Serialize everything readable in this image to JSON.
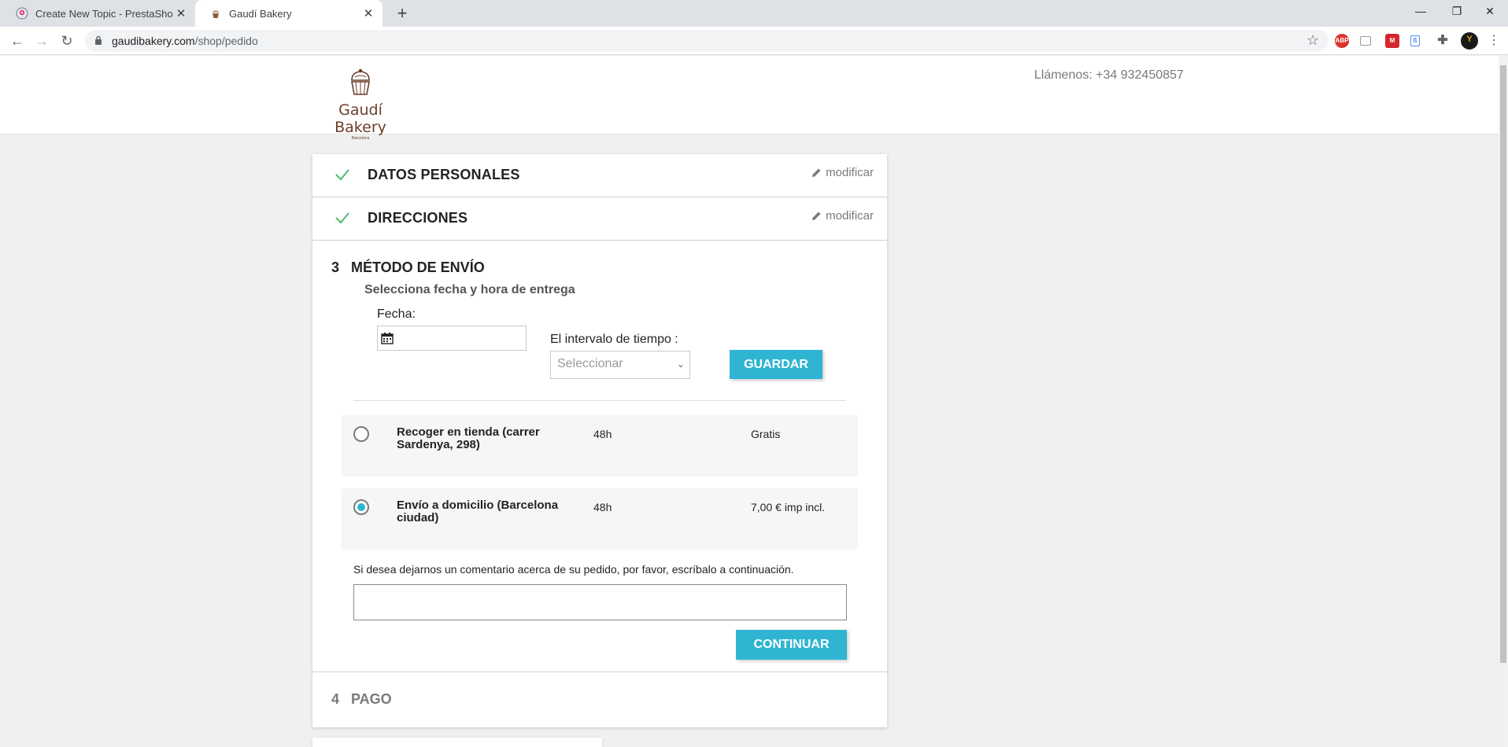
{
  "browser": {
    "tabs": [
      {
        "title": "Create New Topic - PrestaShop F",
        "icon": "prestashop-favicon-icon"
      },
      {
        "title": "Gaudí Bakery",
        "icon": "cupcake-favicon-icon"
      }
    ],
    "url_host": "gaudibakery.com",
    "url_path": "/shop/pedido"
  },
  "header": {
    "logo_text": "Gaudí Bakery",
    "logo_sub": "Barcelona",
    "phone": "Llámenos: +34 932450857"
  },
  "checkout": {
    "edit_label": "modificar",
    "steps_done": [
      "DATOS PERSONALES",
      "DIRECCIONES"
    ],
    "current": {
      "number": "3",
      "title": "MÉTODO DE ENVÍO",
      "subtitle": "Selecciona fecha y hora de entrega",
      "fecha_label": "Fecha:",
      "fecha_value": "",
      "interval_label": "El intervalo de tiempo :",
      "interval_selected": "Seleccionar",
      "save_label": "GUARDAR",
      "carriers": [
        {
          "name": "Recoger en tienda (carrer Sardenya, 298)",
          "delay": "48h",
          "price": "Gratis",
          "selected": false
        },
        {
          "name": "Envío a domicilio (Barcelona ciudad)",
          "delay": "48h",
          "price": "7,00 € imp incl.",
          "selected": true
        }
      ],
      "comment_label": "Si desea dejarnos un comentario acerca de su pedido, por favor, escríbalo a continuación.",
      "comment_value": "",
      "continue_label": "CONTINUAR"
    },
    "next": {
      "number": "4",
      "title": "PAGO"
    }
  },
  "colors": {
    "accent": "#2fb5d2",
    "check": "#4cbb6c",
    "brand": "#6b3e2a"
  }
}
